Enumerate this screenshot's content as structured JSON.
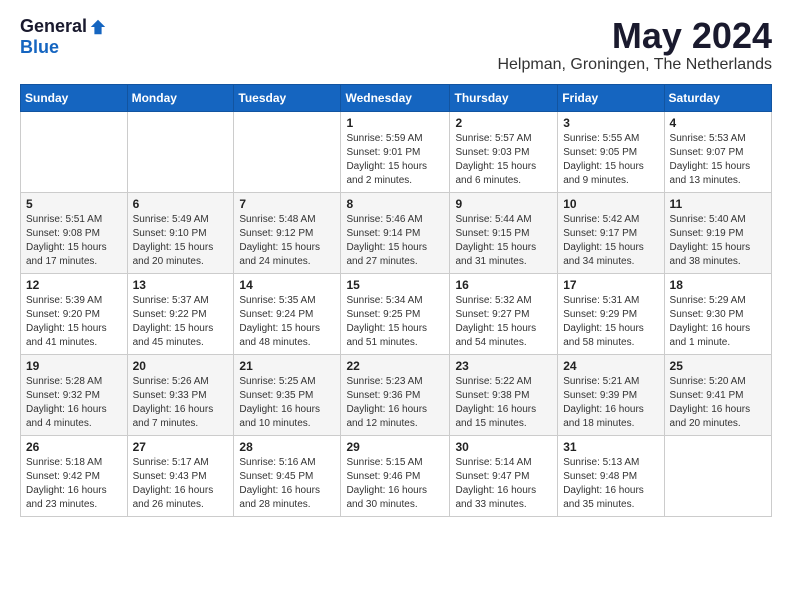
{
  "header": {
    "logo": {
      "general": "General",
      "blue": "Blue"
    },
    "title": "May 2024",
    "location": "Helpman, Groningen, The Netherlands"
  },
  "calendar": {
    "days": [
      "Sunday",
      "Monday",
      "Tuesday",
      "Wednesday",
      "Thursday",
      "Friday",
      "Saturday"
    ],
    "weeks": [
      [
        {
          "day": "",
          "info": ""
        },
        {
          "day": "",
          "info": ""
        },
        {
          "day": "",
          "info": ""
        },
        {
          "day": "1",
          "info": "Sunrise: 5:59 AM\nSunset: 9:01 PM\nDaylight: 15 hours\nand 2 minutes."
        },
        {
          "day": "2",
          "info": "Sunrise: 5:57 AM\nSunset: 9:03 PM\nDaylight: 15 hours\nand 6 minutes."
        },
        {
          "day": "3",
          "info": "Sunrise: 5:55 AM\nSunset: 9:05 PM\nDaylight: 15 hours\nand 9 minutes."
        },
        {
          "day": "4",
          "info": "Sunrise: 5:53 AM\nSunset: 9:07 PM\nDaylight: 15 hours\nand 13 minutes."
        }
      ],
      [
        {
          "day": "5",
          "info": "Sunrise: 5:51 AM\nSunset: 9:08 PM\nDaylight: 15 hours\nand 17 minutes."
        },
        {
          "day": "6",
          "info": "Sunrise: 5:49 AM\nSunset: 9:10 PM\nDaylight: 15 hours\nand 20 minutes."
        },
        {
          "day": "7",
          "info": "Sunrise: 5:48 AM\nSunset: 9:12 PM\nDaylight: 15 hours\nand 24 minutes."
        },
        {
          "day": "8",
          "info": "Sunrise: 5:46 AM\nSunset: 9:14 PM\nDaylight: 15 hours\nand 27 minutes."
        },
        {
          "day": "9",
          "info": "Sunrise: 5:44 AM\nSunset: 9:15 PM\nDaylight: 15 hours\nand 31 minutes."
        },
        {
          "day": "10",
          "info": "Sunrise: 5:42 AM\nSunset: 9:17 PM\nDaylight: 15 hours\nand 34 minutes."
        },
        {
          "day": "11",
          "info": "Sunrise: 5:40 AM\nSunset: 9:19 PM\nDaylight: 15 hours\nand 38 minutes."
        }
      ],
      [
        {
          "day": "12",
          "info": "Sunrise: 5:39 AM\nSunset: 9:20 PM\nDaylight: 15 hours\nand 41 minutes."
        },
        {
          "day": "13",
          "info": "Sunrise: 5:37 AM\nSunset: 9:22 PM\nDaylight: 15 hours\nand 45 minutes."
        },
        {
          "day": "14",
          "info": "Sunrise: 5:35 AM\nSunset: 9:24 PM\nDaylight: 15 hours\nand 48 minutes."
        },
        {
          "day": "15",
          "info": "Sunrise: 5:34 AM\nSunset: 9:25 PM\nDaylight: 15 hours\nand 51 minutes."
        },
        {
          "day": "16",
          "info": "Sunrise: 5:32 AM\nSunset: 9:27 PM\nDaylight: 15 hours\nand 54 minutes."
        },
        {
          "day": "17",
          "info": "Sunrise: 5:31 AM\nSunset: 9:29 PM\nDaylight: 15 hours\nand 58 minutes."
        },
        {
          "day": "18",
          "info": "Sunrise: 5:29 AM\nSunset: 9:30 PM\nDaylight: 16 hours\nand 1 minute."
        }
      ],
      [
        {
          "day": "19",
          "info": "Sunrise: 5:28 AM\nSunset: 9:32 PM\nDaylight: 16 hours\nand 4 minutes."
        },
        {
          "day": "20",
          "info": "Sunrise: 5:26 AM\nSunset: 9:33 PM\nDaylight: 16 hours\nand 7 minutes."
        },
        {
          "day": "21",
          "info": "Sunrise: 5:25 AM\nSunset: 9:35 PM\nDaylight: 16 hours\nand 10 minutes."
        },
        {
          "day": "22",
          "info": "Sunrise: 5:23 AM\nSunset: 9:36 PM\nDaylight: 16 hours\nand 12 minutes."
        },
        {
          "day": "23",
          "info": "Sunrise: 5:22 AM\nSunset: 9:38 PM\nDaylight: 16 hours\nand 15 minutes."
        },
        {
          "day": "24",
          "info": "Sunrise: 5:21 AM\nSunset: 9:39 PM\nDaylight: 16 hours\nand 18 minutes."
        },
        {
          "day": "25",
          "info": "Sunrise: 5:20 AM\nSunset: 9:41 PM\nDaylight: 16 hours\nand 20 minutes."
        }
      ],
      [
        {
          "day": "26",
          "info": "Sunrise: 5:18 AM\nSunset: 9:42 PM\nDaylight: 16 hours\nand 23 minutes."
        },
        {
          "day": "27",
          "info": "Sunrise: 5:17 AM\nSunset: 9:43 PM\nDaylight: 16 hours\nand 26 minutes."
        },
        {
          "day": "28",
          "info": "Sunrise: 5:16 AM\nSunset: 9:45 PM\nDaylight: 16 hours\nand 28 minutes."
        },
        {
          "day": "29",
          "info": "Sunrise: 5:15 AM\nSunset: 9:46 PM\nDaylight: 16 hours\nand 30 minutes."
        },
        {
          "day": "30",
          "info": "Sunrise: 5:14 AM\nSunset: 9:47 PM\nDaylight: 16 hours\nand 33 minutes."
        },
        {
          "day": "31",
          "info": "Sunrise: 5:13 AM\nSunset: 9:48 PM\nDaylight: 16 hours\nand 35 minutes."
        },
        {
          "day": "",
          "info": ""
        }
      ]
    ]
  }
}
